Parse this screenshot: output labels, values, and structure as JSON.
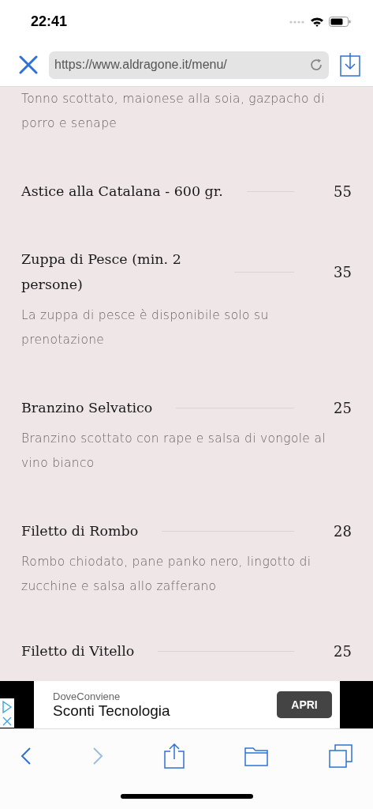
{
  "status_bar": {
    "time": "22:41"
  },
  "browser": {
    "url": "https://www.aldragone.it/menu/"
  },
  "menu": {
    "intro_description": "Tonno scottato, maionese alla soia, gazpacho di porro e senape",
    "items": [
      {
        "name": "Astice alla Catalana - 600 gr.",
        "price": "55"
      },
      {
        "name": "Zuppa di Pesce (min. 2 persone)",
        "price": "35",
        "description": "La zuppa di pesce è disponibile solo su prenotazione"
      },
      {
        "name": "Branzino Selvatico",
        "price": "25",
        "description": "Branzino scottato con rape e salsa di vongole al vino bianco"
      },
      {
        "name": "Filetto di Rombo",
        "price": "28",
        "description": "Rombo chiodato, pane panko nero, lingotto di zucchine e salsa allo zafferano"
      },
      {
        "name": "Filetto di Vitello",
        "price": "25"
      }
    ]
  },
  "ad": {
    "advertiser": "DoveConviene",
    "headline": "Sconti Tecnologia",
    "button": "APRI"
  },
  "toolbar": {
    "back_disabled": false,
    "forward_disabled": true
  }
}
